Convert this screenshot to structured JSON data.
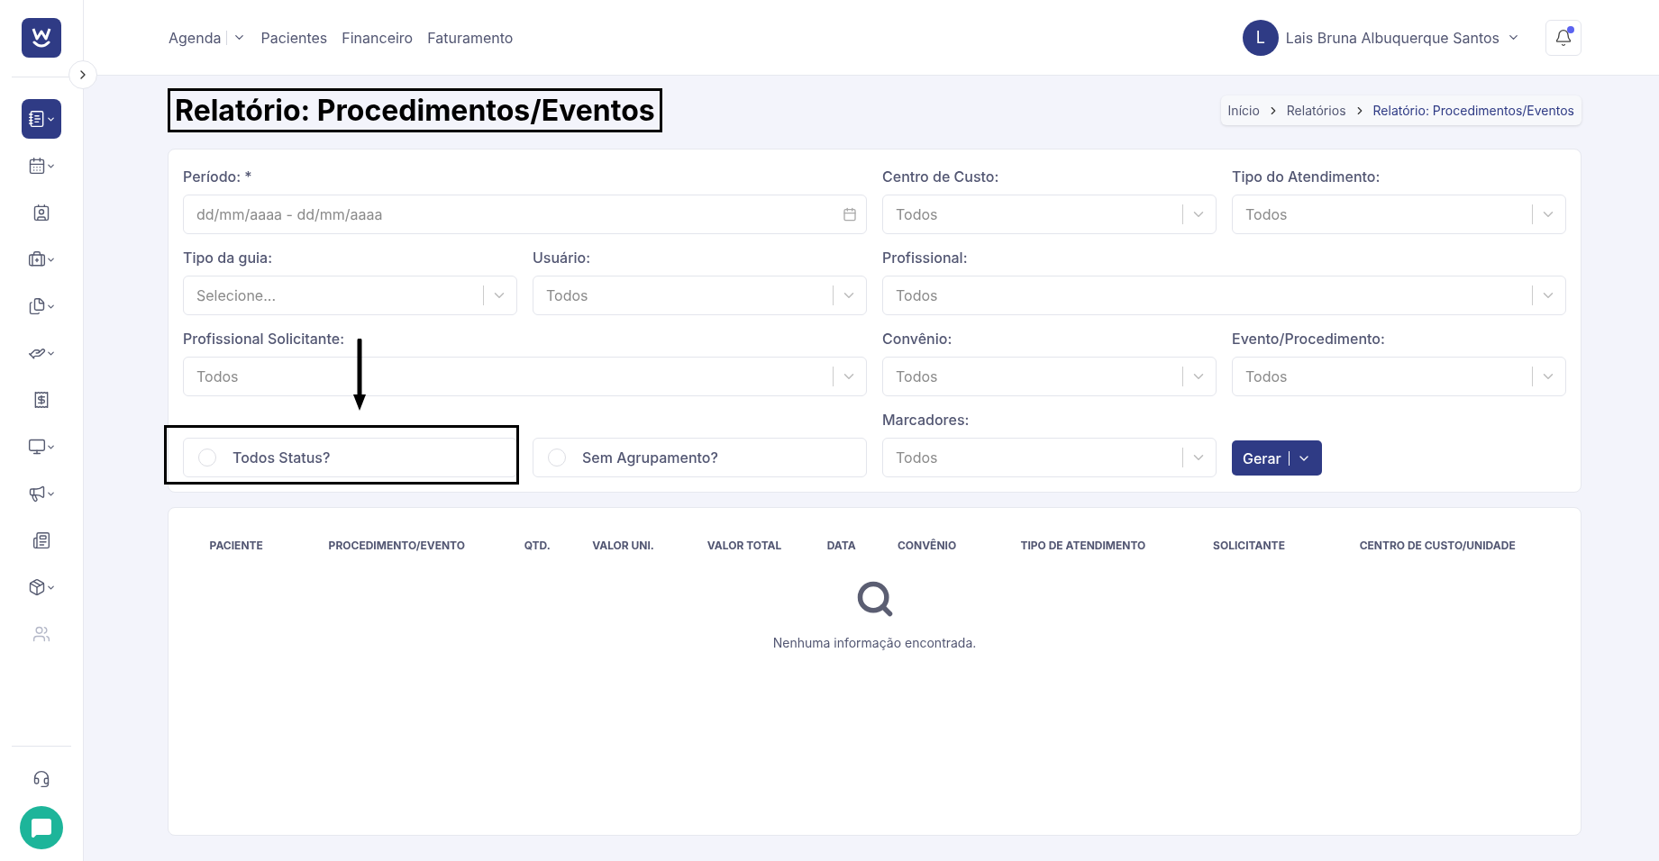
{
  "sidebar": {
    "items": [
      {
        "kind": "notebook",
        "selected": true,
        "expandable": true,
        "disabled": false
      },
      {
        "kind": "calendar",
        "selected": false,
        "expandable": true,
        "disabled": false
      },
      {
        "kind": "contact",
        "selected": false,
        "expandable": false,
        "disabled": false
      },
      {
        "kind": "medical-kit",
        "selected": false,
        "expandable": true,
        "disabled": false
      },
      {
        "kind": "files",
        "selected": false,
        "expandable": true,
        "disabled": false
      },
      {
        "kind": "hand",
        "selected": false,
        "expandable": true,
        "disabled": false
      },
      {
        "kind": "receipt",
        "selected": false,
        "expandable": false,
        "disabled": false
      },
      {
        "kind": "monitor",
        "selected": false,
        "expandable": true,
        "disabled": false
      },
      {
        "kind": "megaphone",
        "selected": false,
        "expandable": true,
        "disabled": false
      },
      {
        "kind": "newspaper",
        "selected": false,
        "expandable": false,
        "disabled": false
      },
      {
        "kind": "package",
        "selected": false,
        "expandable": true,
        "disabled": false
      },
      {
        "kind": "users",
        "selected": false,
        "expandable": false,
        "disabled": true
      }
    ]
  },
  "nav": [
    {
      "label": "Agenda",
      "dropdown": true
    },
    {
      "label": "Pacientes",
      "dropdown": false
    },
    {
      "label": "Financeiro",
      "dropdown": false
    },
    {
      "label": "Faturamento",
      "dropdown": false
    }
  ],
  "user": {
    "initial": "L",
    "name": "Lais Bruna Albuquerque Santos"
  },
  "notifications": {
    "unread": true
  },
  "page_title": {
    "text": "Relatório: Procedimentos/Eventos",
    "highlighted": true
  },
  "breadcrumb": [
    {
      "label": "Início",
      "current": false
    },
    {
      "label": "Relatórios",
      "current": false
    },
    {
      "label": "Relatório: Procedimentos/Eventos",
      "current": true
    }
  ],
  "filters": [
    {
      "kind": "date",
      "label": "Período: *",
      "placeholder": "dd/mm/aaaa - dd/mm/aaaa"
    },
    {
      "kind": "select",
      "label": "Centro de Custo:",
      "placeholder": "Todos"
    },
    {
      "kind": "select",
      "label": "Tipo do Atendimento:",
      "placeholder": "Todos"
    },
    {
      "kind": "select",
      "label": "Tipo da guia:",
      "placeholder": "Selecione..."
    },
    {
      "kind": "select",
      "label": "Usuário:",
      "placeholder": "Todos"
    },
    {
      "kind": "select",
      "label": "Profissional:",
      "placeholder": "Todos"
    },
    {
      "kind": "select",
      "label": "Profissional Solicitante:",
      "placeholder": "Todos"
    },
    {
      "kind": "select",
      "label": "Convênio:",
      "placeholder": "Todos"
    },
    {
      "kind": "select",
      "label": "Evento/Procedimento:",
      "placeholder": "Todos"
    },
    {
      "kind": "checkbox",
      "text": "Todos Status?",
      "checked": false,
      "highlighted": true
    },
    {
      "kind": "checkbox",
      "text": "Sem Agrupamento?",
      "checked": false,
      "highlighted": false
    },
    {
      "kind": "select",
      "label": "Marcadores:",
      "placeholder": "Todos"
    },
    {
      "kind": "button",
      "text": "Gerar"
    }
  ],
  "table": {
    "columns": [
      "PACIENTE",
      "PROCEDIMENTO/EVENTO",
      "QTD.",
      "VALOR UNI.",
      "VALOR TOTAL",
      "DATA",
      "CONVÊNIO",
      "TIPO DE ATENDIMENTO",
      "SOLICITANTE",
      "CENTRO DE CUSTO/UNIDADE"
    ],
    "empty_message": "Nenhuma informação encontrada."
  }
}
